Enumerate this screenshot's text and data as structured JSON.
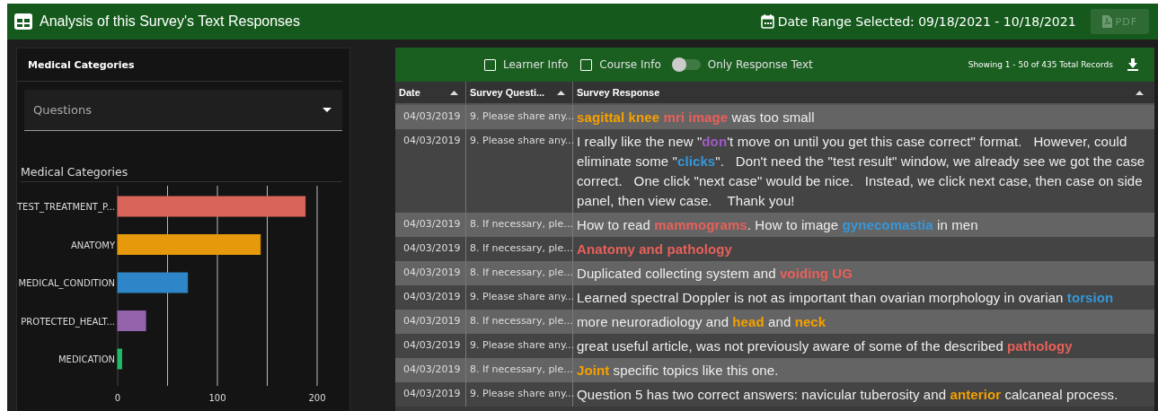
{
  "header": {
    "title": "Analysis of this Survey's Text Responses",
    "date_range": "Date Range Selected: 09/18/2021 - 10/18/2021",
    "pdf_button": {
      "label": "PDF",
      "disabled": true
    }
  },
  "categories_panel": {
    "title": "Medical Categories",
    "questions_select": {
      "placeholder": "Questions"
    },
    "chart_title": "Medical Categories",
    "chart_data": {
      "type": "bar",
      "orientation": "horizontal",
      "stacked": true,
      "categories": [
        "TEST_TREATMENT_P...",
        "ANATOMY",
        "MEDICAL_CONDITION",
        "PROTECTED_HEALT...",
        "MEDICATION"
      ],
      "series": [
        {
          "color": "#d9645a",
          "values": [
            188,
            null,
            null,
            null,
            null
          ]
        },
        {
          "color": "#e6990a",
          "values": [
            null,
            143,
            null,
            null,
            null
          ]
        },
        {
          "color": "#2e86c8",
          "values": [
            null,
            null,
            70,
            null,
            null
          ]
        },
        {
          "color": "#9563ab",
          "values": [
            null,
            null,
            null,
            28,
            null
          ]
        },
        {
          "color": "#22b866",
          "values": [
            null,
            null,
            null,
            null,
            4
          ]
        }
      ],
      "xlim": [
        0,
        200
      ],
      "xticks": [
        0,
        100,
        200
      ]
    }
  },
  "table_toolbar": {
    "filters": [
      {
        "kind": "checkbox",
        "label": "Learner Info",
        "checked": false
      },
      {
        "kind": "checkbox",
        "label": "Course Info",
        "checked": false
      },
      {
        "kind": "toggle",
        "label": "Only Response Text",
        "on": false
      }
    ],
    "records": "Showing 1 - 50 of 435 Total Records"
  },
  "table": {
    "columns": [
      "Date",
      "Survey Questi...",
      "Survey Response"
    ],
    "rows": [
      {
        "date": "04/03/2019",
        "question": "9. Please share any...",
        "response": [
          {
            "text": "sagittal knee ",
            "color": "#f5a000"
          },
          {
            "text": "mri image",
            "color": "#e8605a"
          },
          {
            "text": " was too small"
          }
        ]
      },
      {
        "date": "04/03/2019",
        "question": "9. Please share any...",
        "response": [
          {
            "text": "I really like the new \""
          },
          {
            "text": "don",
            "color": "#a05cc8"
          },
          {
            "text": "'t move on until you get this case correct\" format.   However, could eliminate some \""
          },
          {
            "text": "clicks",
            "color": "#3498db"
          },
          {
            "text": "\".   Don't need the \"test result\" window, we already see we got the case correct.   One click \"next case\" would be nice.   Instead, we click next case, then case on side panel, then view case.    Thank you!"
          }
        ]
      },
      {
        "date": "04/03/2019",
        "question": "8. If necessary, ple...",
        "response": [
          {
            "text": "How to read "
          },
          {
            "text": "mammograms",
            "color": "#e8605a"
          },
          {
            "text": ". How to image "
          },
          {
            "text": "gynecomastia",
            "color": "#3498db"
          },
          {
            "text": " in men"
          }
        ]
      },
      {
        "date": "04/03/2019",
        "question": "8. If necessary, ple...",
        "response": [
          {
            "text": "Anatomy and pathology",
            "color": "#e8605a"
          }
        ]
      },
      {
        "date": "04/03/2019",
        "question": "8. If necessary, ple...",
        "response": [
          {
            "text": "Duplicated collecting system and "
          },
          {
            "text": "voiding UG",
            "color": "#e8605a"
          }
        ]
      },
      {
        "date": "04/03/2019",
        "question": "9. Please share any...",
        "response": [
          {
            "text": "Learned spectral Doppler is not as important than ovarian morphology in ovarian "
          },
          {
            "text": "torsion",
            "color": "#3498db"
          }
        ]
      },
      {
        "date": "04/03/2019",
        "question": "8. If necessary, ple...",
        "response": [
          {
            "text": "more neuroradiology and "
          },
          {
            "text": "head",
            "color": "#f5a000"
          },
          {
            "text": " and "
          },
          {
            "text": "neck",
            "color": "#f5a000"
          }
        ]
      },
      {
        "date": "04/03/2019",
        "question": "9. Please share any...",
        "response": [
          {
            "text": "great useful article, was not previously aware of some of the described "
          },
          {
            "text": "pathology",
            "color": "#e8605a"
          }
        ]
      },
      {
        "date": "04/03/2019",
        "question": "8. If necessary, ple...",
        "response": [
          {
            "text": "Joint",
            "color": "#f5a000"
          },
          {
            "text": " specific topics like this one."
          }
        ]
      },
      {
        "date": "04/03/2019",
        "question": "9. Please share any...",
        "response": [
          {
            "text": "Question 5 has two correct answers: navicular tuberosity and "
          },
          {
            "text": "anterior",
            "color": "#f5a000"
          },
          {
            "text": " calcaneal process."
          }
        ]
      }
    ]
  }
}
